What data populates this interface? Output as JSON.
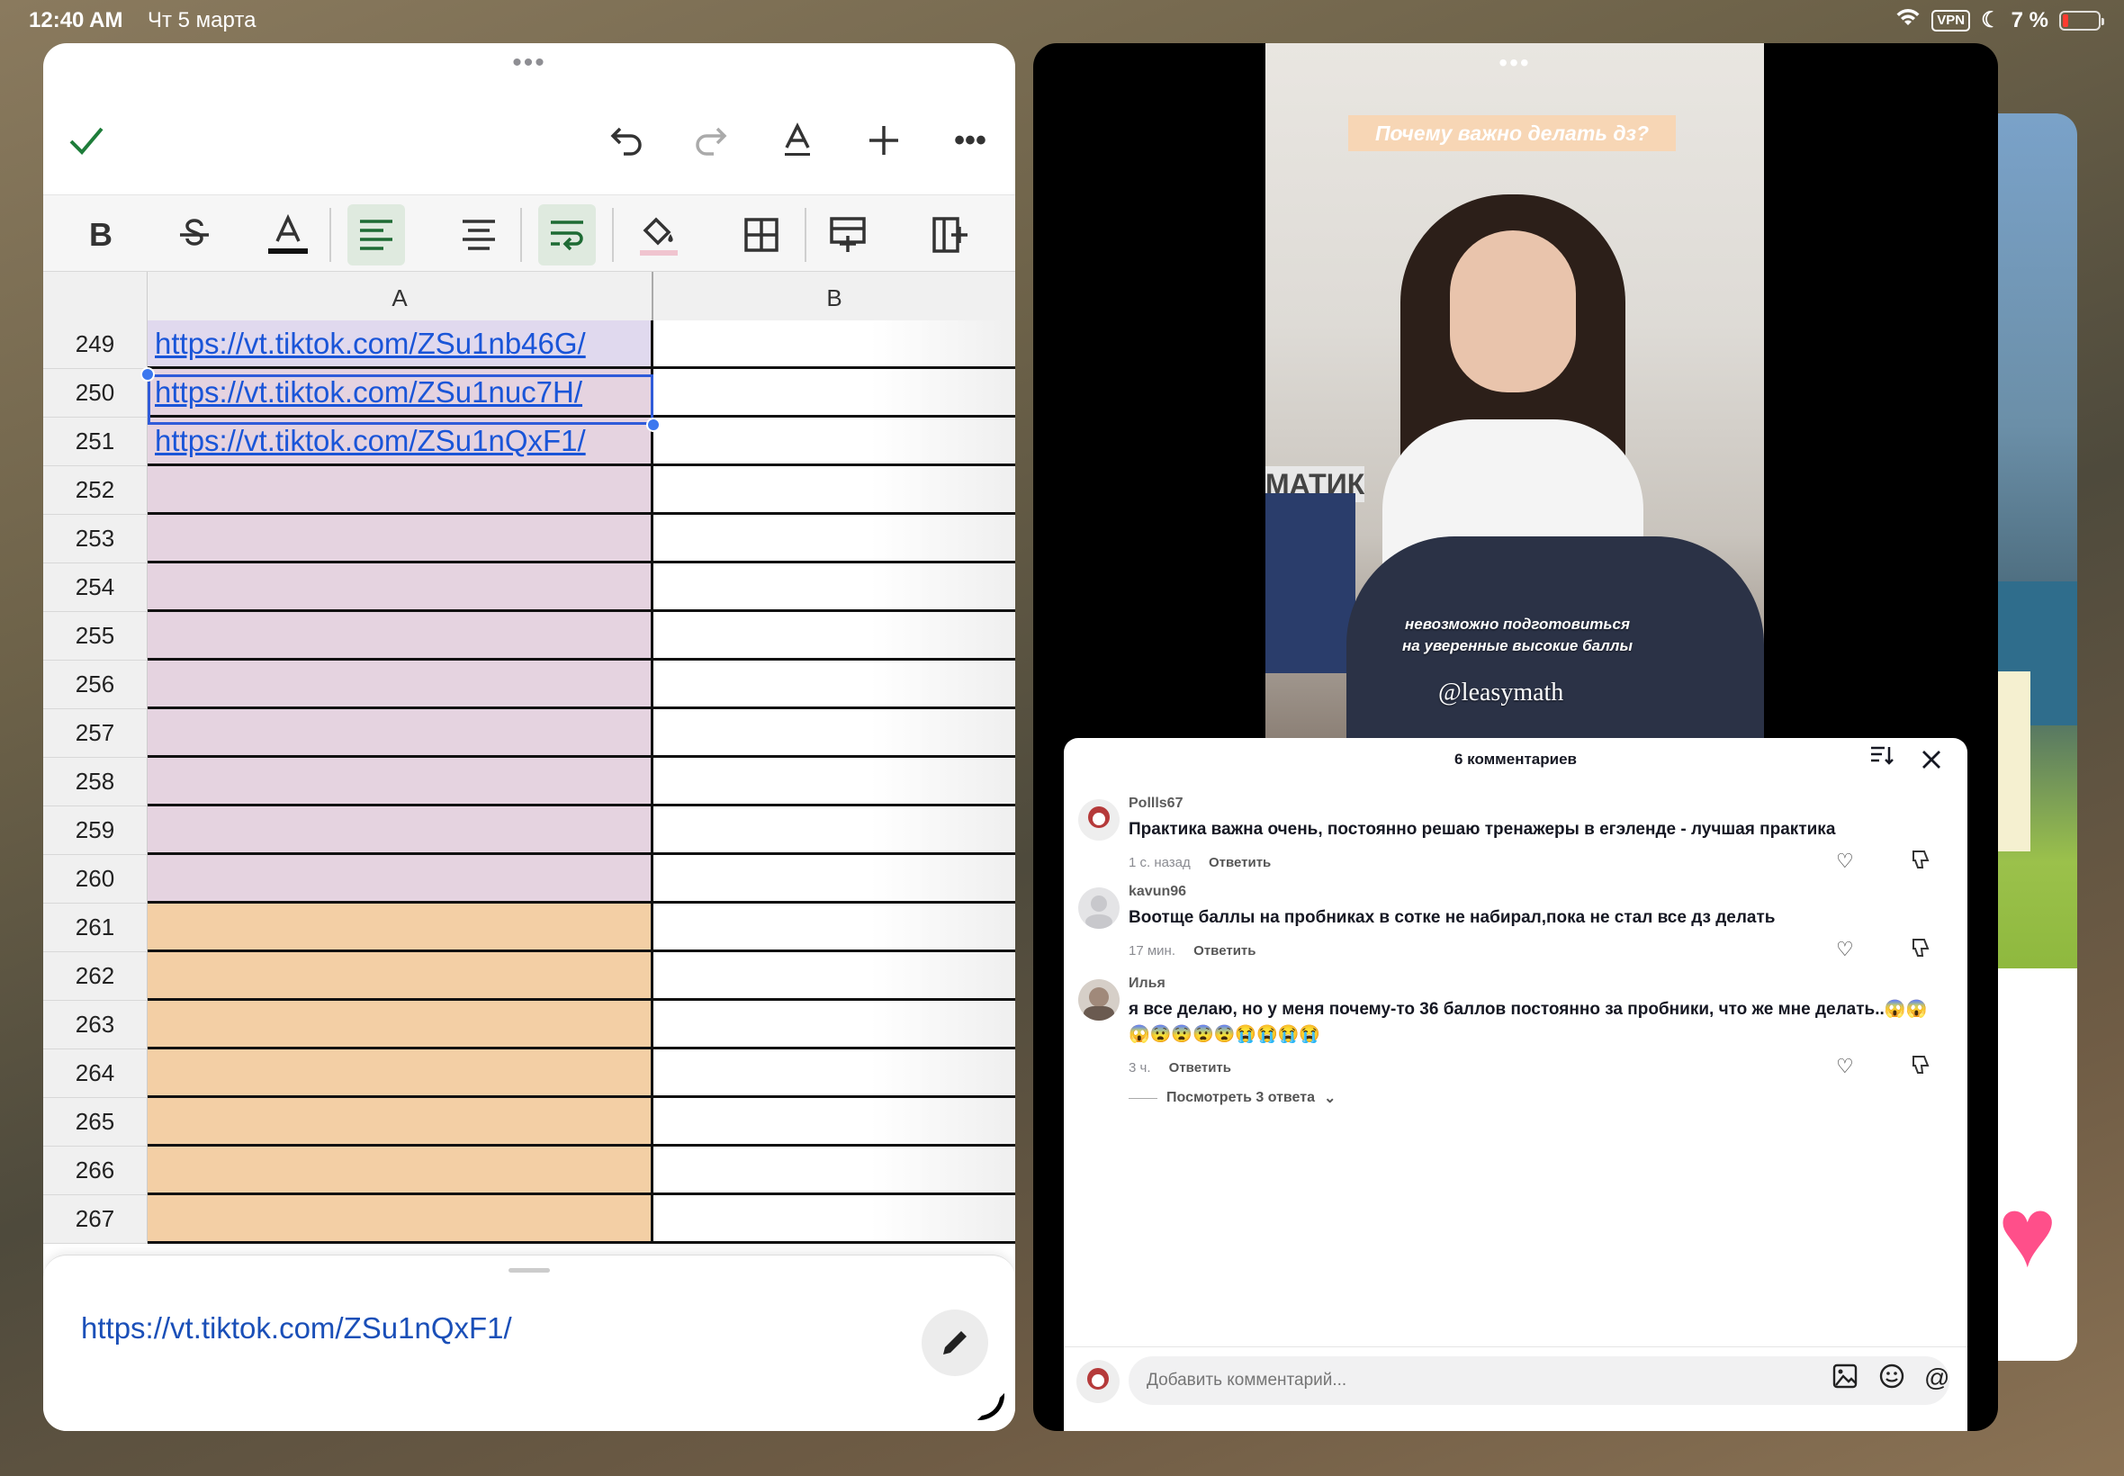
{
  "status_bar": {
    "time": "12:40 AM",
    "date": "Чт 5 марта",
    "vpn": "VPN",
    "battery": "7 %"
  },
  "spreadsheet": {
    "columns": [
      "A",
      "B"
    ],
    "rows": [
      {
        "num": "249",
        "a": "https://vt.tiktok.com/ZSu1nb46G/",
        "color": "#e0d9ee"
      },
      {
        "num": "250",
        "a": "https://vt.tiktok.com/ZSu1nuc7H/",
        "color": "#e5d3e0"
      },
      {
        "num": "251",
        "a": "https://vt.tiktok.com/ZSu1nQxF1/",
        "color": "#e5d3e0"
      },
      {
        "num": "252",
        "a": "",
        "color": "#e5d3e0"
      },
      {
        "num": "253",
        "a": "",
        "color": "#e5d3e0"
      },
      {
        "num": "254",
        "a": "",
        "color": "#e5d3e0"
      },
      {
        "num": "255",
        "a": "",
        "color": "#e5d3e0"
      },
      {
        "num": "256",
        "a": "",
        "color": "#e5d3e0"
      },
      {
        "num": "257",
        "a": "",
        "color": "#e5d3e0"
      },
      {
        "num": "258",
        "a": "",
        "color": "#e5d3e0"
      },
      {
        "num": "259",
        "a": "",
        "color": "#e5d3e0"
      },
      {
        "num": "260",
        "a": "",
        "color": "#e5d3e0"
      },
      {
        "num": "261",
        "a": "",
        "color": "#f3cfa5"
      },
      {
        "num": "262",
        "a": "",
        "color": "#f3cfa5"
      },
      {
        "num": "263",
        "a": "",
        "color": "#f3cfa5"
      },
      {
        "num": "264",
        "a": "",
        "color": "#f3cfa5"
      },
      {
        "num": "265",
        "a": "",
        "color": "#f3cfa5"
      },
      {
        "num": "266",
        "a": "",
        "color": "#f3cfa5"
      },
      {
        "num": "267",
        "a": "",
        "color": "#f3cfa5"
      }
    ],
    "editor_value": "https://vt.tiktok.com/ZSu1nQxF1/"
  },
  "video": {
    "title": "Почему важно делать дз?",
    "subtitle_line1": "невозможно подготовиться",
    "subtitle_line2": "на уверенные высокие баллы",
    "handle": "@leasymath",
    "book_text": "МАТИК"
  },
  "comments_panel": {
    "header": "6 комментариев",
    "comments": [
      {
        "user": "Pollls67",
        "text": "Практика важна очень, постоянно решаю тренажеры в егэленде - лучшая практика",
        "time": "1 с. назад",
        "reply": "Ответить"
      },
      {
        "user": "kavun96",
        "text": "Воотще баллы на пробниках в сотке не набирал,пока не стал все дз делать",
        "time": "17 мин.",
        "reply": "Ответить"
      },
      {
        "user": "Илья",
        "text": "я все делаю, но у меня почему-то 36 баллов постоянно за пробники, что же мне делать..😱😱😱😨😨😨😨😭😭😭😭",
        "time": "3 ч.",
        "reply": "Ответить"
      }
    ],
    "view_replies": "Посмотреть 3 ответа",
    "input_placeholder": "Добавить комментарий..."
  }
}
